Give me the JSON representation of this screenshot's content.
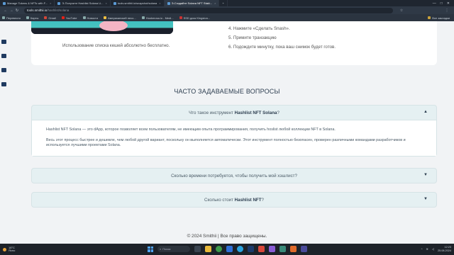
{
  "browser": {
    "tabs": [
      {
        "label": "Manage Tokens & NFTs with F...",
        "active": false
      },
      {
        "label": "Э-Получите Hashlist Solana U...",
        "active": false
      },
      {
        "label": "tools.smithii.io/snapshot/solana",
        "active": false
      },
      {
        "label": "Э-Создайте Solana NFT Staki...",
        "active": true
      }
    ],
    "tab_close": "×",
    "new_tab": "+",
    "window_controls": [
      "—",
      "□",
      "✕"
    ],
    "url_domain": "tools.smithii.io",
    "url_path": "/hashlist/solana",
    "bookmarks": [
      "Перевести",
      "Карты",
      "Gmail",
      "YouTube",
      "Новости",
      "Американский песо...",
      "Hookmosa.io - Medi...",
      "SSD диск Kingston..."
    ],
    "bookmarks_right": "Все закладки"
  },
  "page": {
    "free_text": "Использование списка кешей абсолютно бесплатно.",
    "steps": [
      "4. Нажмите «Сделать Snash».",
      "5. Примите транзакцию",
      "6. Подождите минутку, пока ваш снимок будет готов."
    ],
    "faq": {
      "title": "ЧАСТО ЗАДАВАЕМЫЕ ВОПРОСЫ",
      "items": [
        {
          "q_pre": "Что такое инструмент ",
          "q_bold": "Hashlist NFT Solana",
          "q_post": "?",
          "chevron": "▲",
          "answer_p1": "Hashlist NFT Solana — это dApp, которое позволяет всем пользователям, не имеющим опыта программирования, получить hoslist любой коллекции NFT в Solana.",
          "answer_p2": "Весь этот процесс быстрее и дешевле, чем любой другой вариант, поскольку он выполняется автоматически. Этот инструмент полностью безопасен, проверен различными командами разработчиков и используется лучшими проектами Solana."
        },
        {
          "q_pre": "Сколько времени потребуется, чтобы получить мой хэшлист?",
          "q_bold": "",
          "q_post": "",
          "chevron": "▼"
        },
        {
          "q_pre": "Сколько стоит ",
          "q_bold": "Hashlist NFT",
          "q_post": "?",
          "chevron": "▼"
        }
      ]
    },
    "footer": "© 2024 Smithii | Все право защищены."
  },
  "taskbar": {
    "weather_temp": "18°C",
    "weather_desc": "Ясно",
    "search_placeholder": "Поиск",
    "clock_time": "12:23",
    "clock_date": "25.08.2024"
  }
}
